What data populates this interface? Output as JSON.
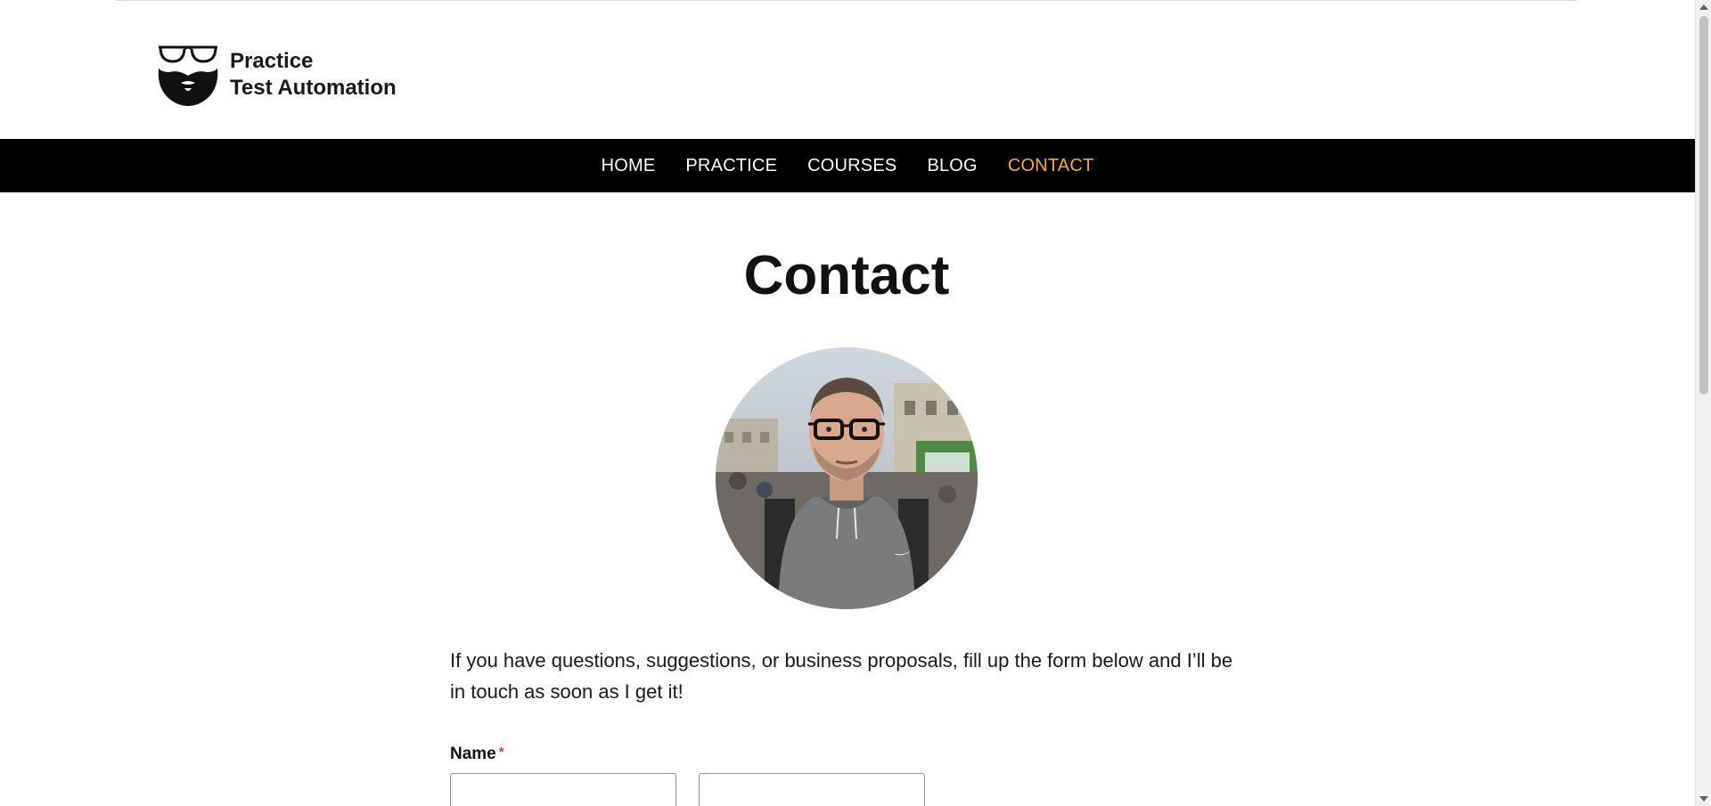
{
  "brand": {
    "line1": "Practice",
    "line2": "Test Automation",
    "logo_icon": "glasses-beard-icon"
  },
  "nav": {
    "items": [
      {
        "label": "HOME",
        "active": false
      },
      {
        "label": "PRACTICE",
        "active": false
      },
      {
        "label": "COURSES",
        "active": false
      },
      {
        "label": "BLOG",
        "active": false
      },
      {
        "label": "CONTACT",
        "active": true
      }
    ],
    "active_color": "#f4a84c",
    "background": "#000000"
  },
  "main": {
    "title": "Contact",
    "avatar_icon": "profile-photo",
    "intro": "If you have questions, suggestions, or business proposals, fill up the form below and I’ll be in touch as soon as I get it!"
  },
  "form": {
    "name_label": "Name",
    "required_marker": "*",
    "first_name_value": "",
    "last_name_value": ""
  }
}
